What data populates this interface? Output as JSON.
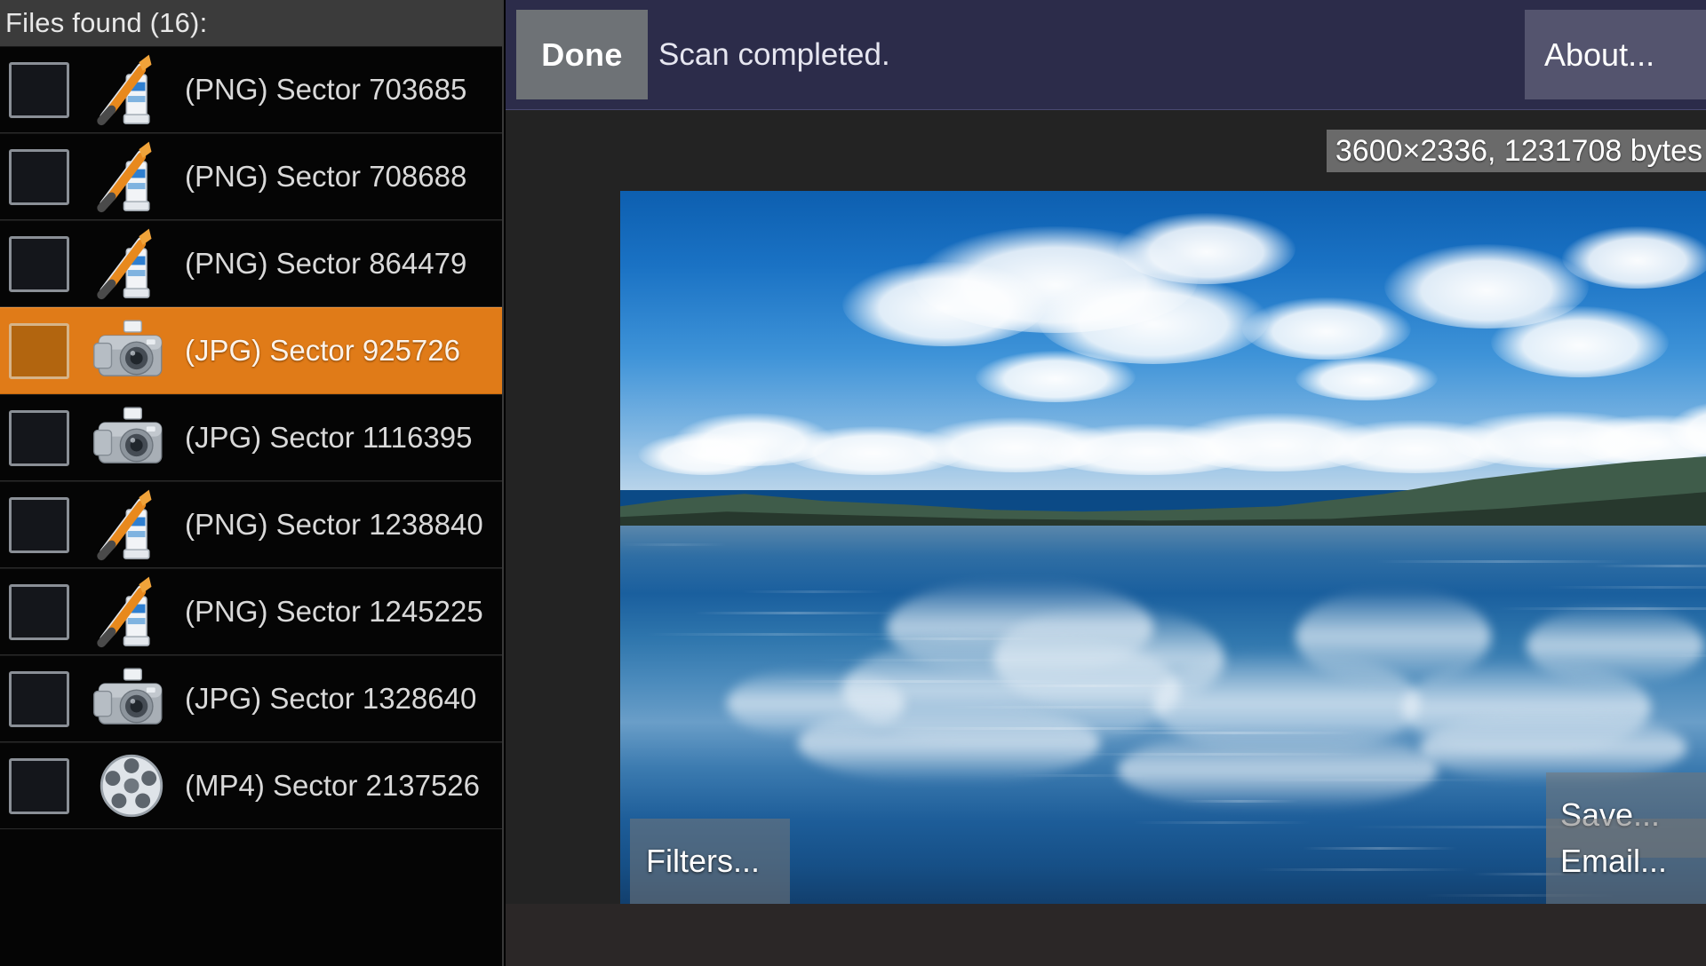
{
  "sidebar": {
    "header": "Files found (16):",
    "files": [
      {
        "type": "PNG",
        "icon": "png-file-icon",
        "label": "(PNG) Sector 703685",
        "selected": false,
        "checked": false
      },
      {
        "type": "PNG",
        "icon": "png-file-icon",
        "label": "(PNG) Sector 708688",
        "selected": false,
        "checked": false
      },
      {
        "type": "PNG",
        "icon": "png-file-icon",
        "label": "(PNG) Sector 864479",
        "selected": false,
        "checked": false
      },
      {
        "type": "JPG",
        "icon": "jpg-camera-icon",
        "label": "(JPG) Sector 925726",
        "selected": true,
        "checked": false
      },
      {
        "type": "JPG",
        "icon": "jpg-camera-icon",
        "label": "(JPG) Sector 1116395",
        "selected": false,
        "checked": false
      },
      {
        "type": "PNG",
        "icon": "png-file-icon",
        "label": "(PNG) Sector 1238840",
        "selected": false,
        "checked": false
      },
      {
        "type": "PNG",
        "icon": "png-file-icon",
        "label": "(PNG) Sector 1245225",
        "selected": false,
        "checked": false
      },
      {
        "type": "JPG",
        "icon": "jpg-camera-icon",
        "label": "(JPG) Sector 1328640",
        "selected": false,
        "checked": false
      },
      {
        "type": "MP4",
        "icon": "mp4-film-icon",
        "label": "(MP4) Sector 2137526",
        "selected": false,
        "checked": false
      }
    ]
  },
  "topbar": {
    "done_label": "Done",
    "status": "Scan completed.",
    "about_label": "About..."
  },
  "preview": {
    "image_info": "3600×2336, 1231708 bytes",
    "image_description": "Lake landscape with blue sky, white clouds, forested hills and mirror-like water reflections"
  },
  "overlay_buttons": {
    "filters_label": "Filters...",
    "save_label": "Save...",
    "email_label": "Email..."
  },
  "colors": {
    "selection_orange": "#e07b18",
    "topbar_navy": "#2c2c4a",
    "panel_dark": "#232323",
    "sidebar_black": "#050505"
  }
}
